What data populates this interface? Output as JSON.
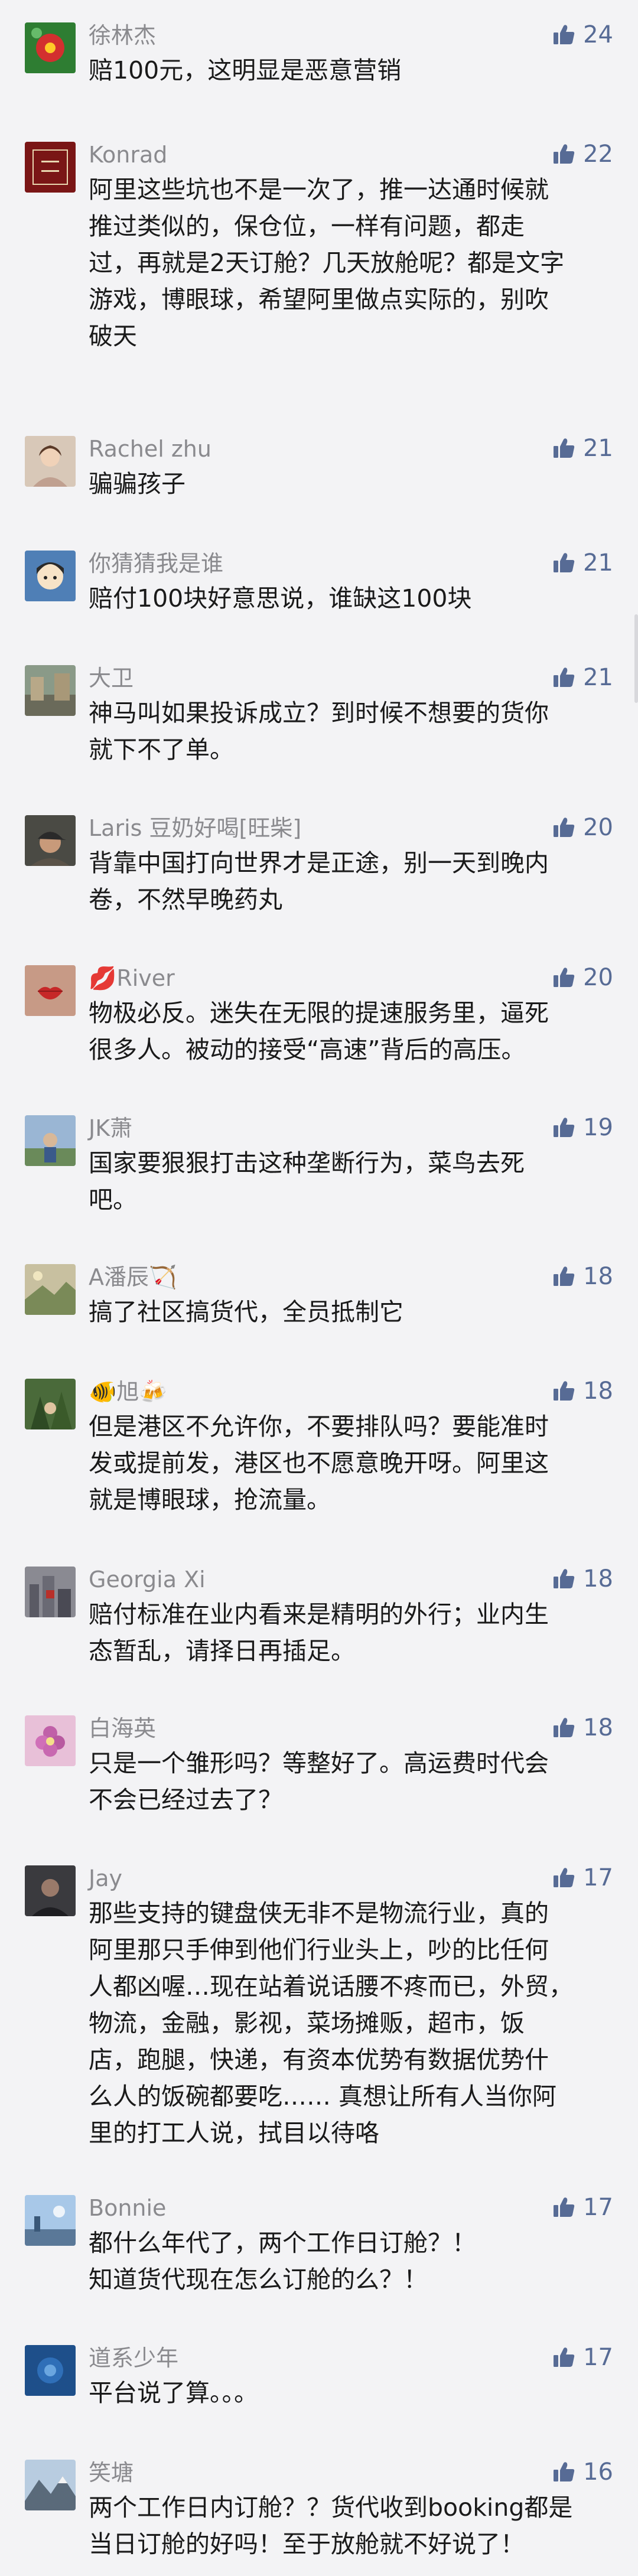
{
  "comments": [
    {
      "user": "徐林杰",
      "likes": "24",
      "text": "赔100元，这明显是恶意营销",
      "avatar": "red-flower-avatar"
    },
    {
      "user": "Konrad",
      "likes": "22",
      "text": "阿里这些坑也不是一次了，推一达通时候就\n推过类似的，保仓位，一样有问题，都走\n过，再就是2天订舱？几天放舱呢？都是文字\n游戏，博眼球，希望阿里做点实际的，别吹\n破天",
      "avatar": "calligraphy-avatar"
    },
    {
      "user": "Rachel zhu",
      "likes": "21",
      "text": "骗骗孩子",
      "avatar": "portrait-avatar"
    },
    {
      "user": "你猜猜我是谁",
      "likes": "21",
      "text": "赔付100块好意思说，谁缺这100块",
      "avatar": "cartoon-avatar"
    },
    {
      "user": "大卫",
      "likes": "21",
      "text": "神马叫如果投诉成立？到时候不想要的货你\n就下不了单。",
      "avatar": "street-avatar"
    },
    {
      "user": "Laris 豆奶好喝[旺柴]",
      "likes": "20",
      "text": "背靠中国打向世界才是正途，别一天到晚内\n卷，不然早晚药丸",
      "avatar": "cap-man-avatar"
    },
    {
      "user": "River",
      "user_prefix": "💋",
      "likes": "20",
      "text": "物极必反。迷失在无限的提速服务里，逼死\n很多人。被动的接受“高速”背后的高压。",
      "avatar": "lips-avatar"
    },
    {
      "user": "JK萧",
      "likes": "19",
      "text": "国家要狠狠打击这种垄断行为，菜鸟去死\n吧。",
      "avatar": "outdoor-avatar"
    },
    {
      "user": "A潘辰🏹",
      "likes": "18",
      "text": "搞了社区搞货代，全员抵制它",
      "avatar": "landscape-avatar"
    },
    {
      "user": "旭",
      "user_prefix": "🐠",
      "user_suffix": "🍻",
      "likes": "18",
      "text": "但是港区不允许你，不要排队吗？要能准时\n发或提前发，港区也不愿意晚开呀。阿里这\n就是博眼球，抢流量。",
      "avatar": "forest-avatar"
    },
    {
      "user": "Georgia Xi",
      "likes": "18",
      "text": "赔付标准在业内看来是精明的外行；业内生\n态暂乱，请择日再插足。",
      "avatar": "city-avatar"
    },
    {
      "user": "白海英",
      "likes": "18",
      "text": "只是一个雏形吗？等整好了。高运费时代会\n不会已经过去了？",
      "avatar": "flower-avatar"
    },
    {
      "user": "Jay",
      "likes": "17",
      "text": "那些支持的键盘侠无非不是物流行业，真的\n阿里那只手伸到他们行业头上，吵的比任何\n人都凶喔…现在站着说话腰不疼而已，外贸，\n物流，金融，影视，菜场摊贩，超市，饭\n店，跑腿，快递，有资本优势有数据优势什\n么人的饭碗都要吃……  真想让所有人当你阿\n里的打工人说，拭目以待咯",
      "avatar": "dark-portrait-avatar"
    },
    {
      "user": "Bonnie",
      "likes": "17",
      "text": "都什么年代了，两个工作日订舱？！\n知道货代现在怎么订舱的么？！",
      "avatar": "sky-avatar"
    },
    {
      "user": "道系少年",
      "likes": "17",
      "text": "平台说了算。。。",
      "avatar": "blue-avatar"
    },
    {
      "user": "笑塘",
      "likes": "16",
      "text": "两个工作日内订舱？？货代收到booking都是\n当日订舱的好吗！至于放舱就不好说了！",
      "avatar": "mountain-avatar"
    }
  ],
  "colors": {
    "background": "#f3f3f5",
    "username": "#8a8a8e",
    "like": "#576b95",
    "text": "#1a1a1a"
  },
  "icons": {
    "like": "thumbs-up-icon"
  }
}
